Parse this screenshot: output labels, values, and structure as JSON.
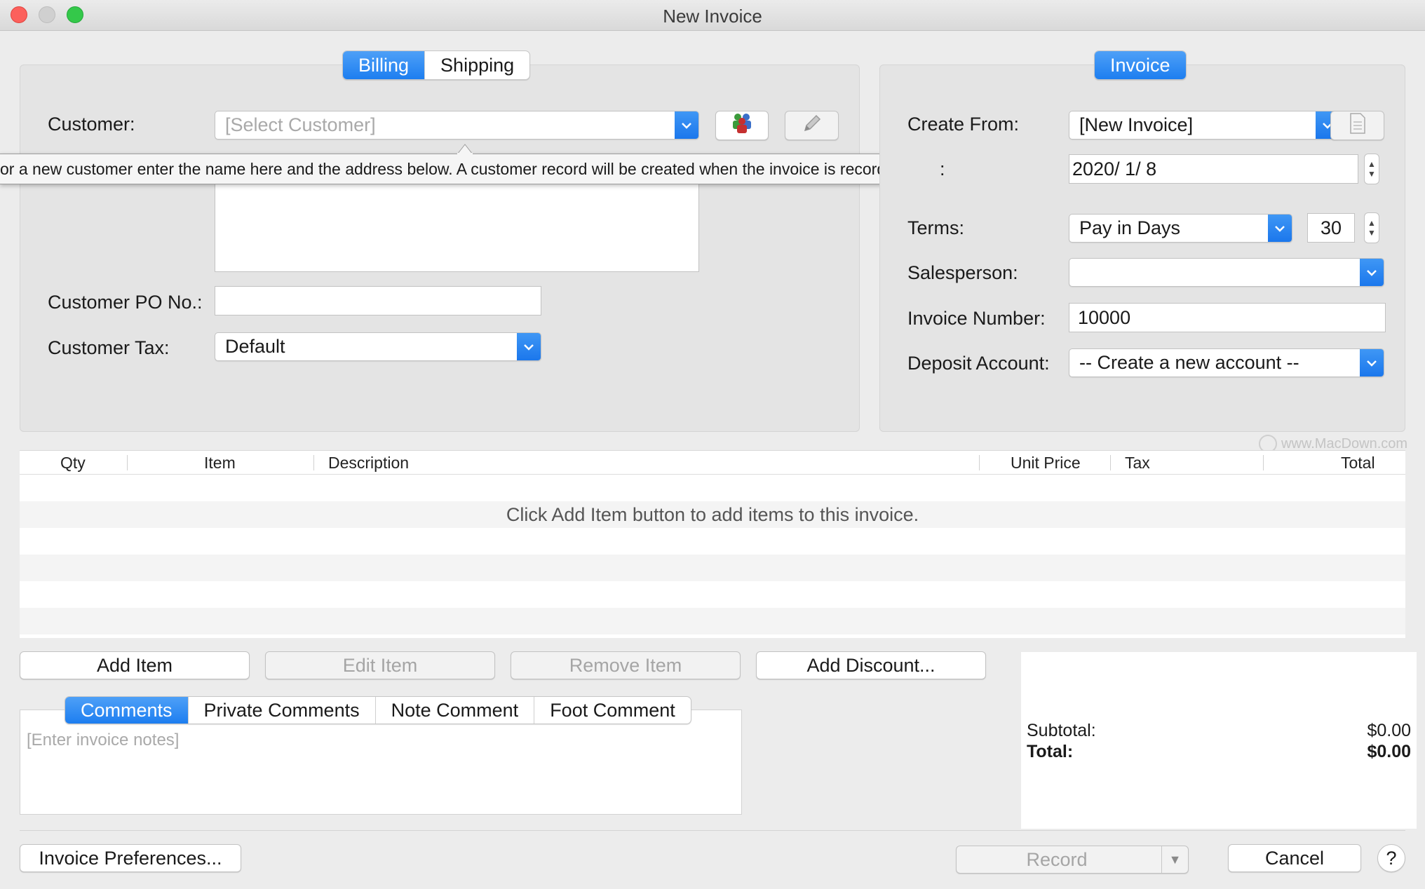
{
  "window": {
    "title": "New Invoice"
  },
  "billing": {
    "tabs": [
      {
        "label": "Billing"
      },
      {
        "label": "Shipping"
      }
    ],
    "customer_label": "Customer:",
    "customer_placeholder": "[Select Customer]",
    "tooltip": "or a new customer enter the name here and the address below. A customer record will be created when the invoice is recorded.",
    "po_label": "Customer PO No.:",
    "po_value": "",
    "tax_label": "Customer Tax:",
    "tax_value": "Default"
  },
  "invoice": {
    "tab_label": "Invoice",
    "create_from_label": "Create From:",
    "create_from_value": "[New Invoice]",
    "date_label_tail": ":",
    "date_value": "2020/  1/  8",
    "terms_label": "Terms:",
    "terms_value": "Pay in Days",
    "terms_days": "30",
    "salesperson_label": "Salesperson:",
    "salesperson_value": "",
    "number_label": "Invoice Number:",
    "number_value": "10000",
    "deposit_label": "Deposit Account:",
    "deposit_value": "-- Create a new account --"
  },
  "table": {
    "columns": [
      "Qty",
      "Item",
      "Description",
      "Unit Price",
      "Tax",
      "Total"
    ],
    "empty_message": "Click Add Item button to add items to this invoice."
  },
  "watermark": "www.MacDown.com",
  "item_buttons": {
    "add": "Add Item",
    "edit": "Edit Item",
    "remove": "Remove Item",
    "discount": "Add Discount..."
  },
  "comments": {
    "tabs": [
      {
        "label": "Comments"
      },
      {
        "label": "Private Comments"
      },
      {
        "label": "Note Comment"
      },
      {
        "label": "Foot Comment"
      }
    ],
    "placeholder": "[Enter invoice notes]"
  },
  "totals": {
    "subtotal_label": "Subtotal:",
    "subtotal_value": "$0.00",
    "total_label": "Total:",
    "total_value": "$0.00"
  },
  "footer": {
    "preferences": "Invoice Preferences...",
    "record": "Record",
    "cancel": "Cancel",
    "help": "?"
  },
  "colors": {
    "accent": "#1d7ef0",
    "window_bg": "#ececec"
  }
}
